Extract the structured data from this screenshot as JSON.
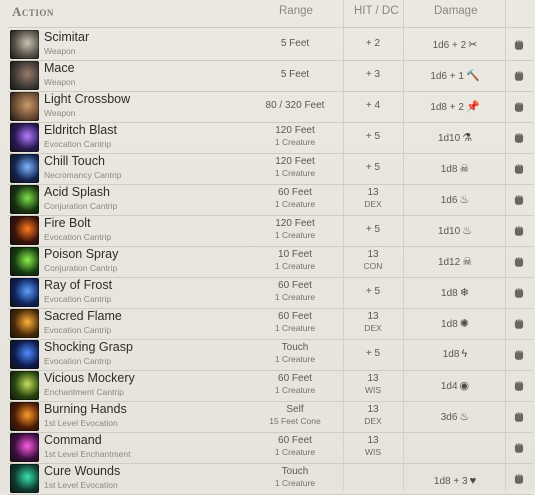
{
  "header": {
    "action": "Action",
    "range": "Range",
    "hit_dc": "HIT / DC",
    "damage": "Damage"
  },
  "rows": [
    {
      "name": "Scimitar",
      "sub": "Weapon",
      "range1": "5 Feet",
      "range2": "",
      "hit": "+ 2",
      "hit_sub": "",
      "damage": "1d6 + 2",
      "dmg_icon": "slashing-icon",
      "dmg_glyph": "✂",
      "icon_color": "#555046",
      "icon_accent": "#c9c2b2"
    },
    {
      "name": "Mace",
      "sub": "Weapon",
      "range1": "5 Feet",
      "range2": "",
      "hit": "+ 3",
      "hit_sub": "",
      "damage": "1d6 + 1",
      "dmg_icon": "bludgeoning-icon",
      "dmg_glyph": "🔨",
      "icon_color": "#3e3a35",
      "icon_accent": "#9a7b6a"
    },
    {
      "name": "Light Crossbow",
      "sub": "Weapon",
      "range1": "80 / 320 Feet",
      "range2": "",
      "hit": "+ 4",
      "hit_sub": "",
      "damage": "1d8 + 2",
      "dmg_icon": "piercing-icon",
      "dmg_glyph": "📌",
      "icon_color": "#6b4a33",
      "icon_accent": "#c79a6a"
    },
    {
      "name": "Eldritch Blast",
      "sub": "Evocation Cantrip",
      "range1": "120 Feet",
      "range2": "1 Creature",
      "hit": "+ 5",
      "hit_sub": "",
      "damage": "1d10",
      "dmg_icon": "force-icon",
      "dmg_glyph": "⚗",
      "icon_color": "#2a1750",
      "icon_accent": "#b07cff"
    },
    {
      "name": "Chill Touch",
      "sub": "Necromancy Cantrip",
      "range1": "120 Feet",
      "range2": "1 Creature",
      "hit": "+ 5",
      "hit_sub": "",
      "damage": "1d8",
      "dmg_icon": "necrotic-icon",
      "dmg_glyph": "☠",
      "icon_color": "#14244f",
      "icon_accent": "#7fb6ff"
    },
    {
      "name": "Acid Splash",
      "sub": "Conjuration Cantrip",
      "range1": "60 Feet",
      "range2": "1 Creature",
      "hit": "13",
      "hit_sub": "DEX",
      "damage": "1d6",
      "dmg_icon": "acid-icon",
      "dmg_glyph": "♨",
      "icon_color": "#17320f",
      "icon_accent": "#7ee04a"
    },
    {
      "name": "Fire Bolt",
      "sub": "Evocation Cantrip",
      "range1": "120 Feet",
      "range2": "1 Creature",
      "hit": "+ 5",
      "hit_sub": "",
      "damage": "1d10",
      "dmg_icon": "fire-icon",
      "dmg_glyph": "♨",
      "icon_color": "#3a120a",
      "icon_accent": "#ff7a1f"
    },
    {
      "name": "Poison Spray",
      "sub": "Conjuration Cantrip",
      "range1": "10 Feet",
      "range2": "1 Creature",
      "hit": "13",
      "hit_sub": "CON",
      "damage": "1d12",
      "dmg_icon": "poison-icon",
      "dmg_glyph": "☠",
      "icon_color": "#143a10",
      "icon_accent": "#8cf04a"
    },
    {
      "name": "Ray of Frost",
      "sub": "Evocation Cantrip",
      "range1": "60 Feet",
      "range2": "1 Creature",
      "hit": "+ 5",
      "hit_sub": "",
      "damage": "1d8",
      "dmg_icon": "cold-icon",
      "dmg_glyph": "❄",
      "icon_color": "#10215a",
      "icon_accent": "#5aa0ff"
    },
    {
      "name": "Sacred Flame",
      "sub": "Evocation Cantrip",
      "range1": "60 Feet",
      "range2": "1 Creature",
      "hit": "13",
      "hit_sub": "DEX",
      "damage": "1d8",
      "dmg_icon": "radiant-icon",
      "dmg_glyph": "✺",
      "icon_color": "#4a2a08",
      "icon_accent": "#ffb23a"
    },
    {
      "name": "Shocking Grasp",
      "sub": "Evocation Cantrip",
      "range1": "Touch",
      "range2": "1 Creature",
      "hit": "+ 5",
      "hit_sub": "",
      "damage": "1d8",
      "dmg_icon": "lightning-icon",
      "dmg_glyph": "ϟ",
      "icon_color": "#0e1a4a",
      "icon_accent": "#4c8cff"
    },
    {
      "name": "Vicious Mockery",
      "sub": "Enchantment Cantrip",
      "range1": "60 Feet",
      "range2": "1 Creature",
      "hit": "13",
      "hit_sub": "WIS",
      "damage": "1d4",
      "dmg_icon": "psychic-icon",
      "dmg_glyph": "◉",
      "icon_color": "#24420f",
      "icon_accent": "#c6e05a"
    },
    {
      "name": "Burning Hands",
      "sub": "1st Level Evocation",
      "range1": "Self",
      "range2": "15 Feet Cone",
      "hit": "13",
      "hit_sub": "DEX",
      "damage": "3d6",
      "dmg_icon": "fire-icon",
      "dmg_glyph": "♨",
      "icon_color": "#4a1a06",
      "icon_accent": "#ff9a2a"
    },
    {
      "name": "Command",
      "sub": "1st Level Enchantment",
      "range1": "60 Feet",
      "range2": "1 Creature",
      "hit": "13",
      "hit_sub": "WIS",
      "damage": "",
      "dmg_icon": "",
      "dmg_glyph": "",
      "icon_color": "#3a0e3e",
      "icon_accent": "#ff5ae0"
    },
    {
      "name": "Cure Wounds",
      "sub": "1st Level Evocation",
      "range1": "Touch",
      "range2": "1 Creature",
      "hit": "",
      "hit_sub": "",
      "damage": "1d8 + 3",
      "dmg_icon": "healing-icon",
      "dmg_glyph": "♥",
      "icon_color": "#0e3a2e",
      "icon_accent": "#3ae0b0"
    }
  ]
}
